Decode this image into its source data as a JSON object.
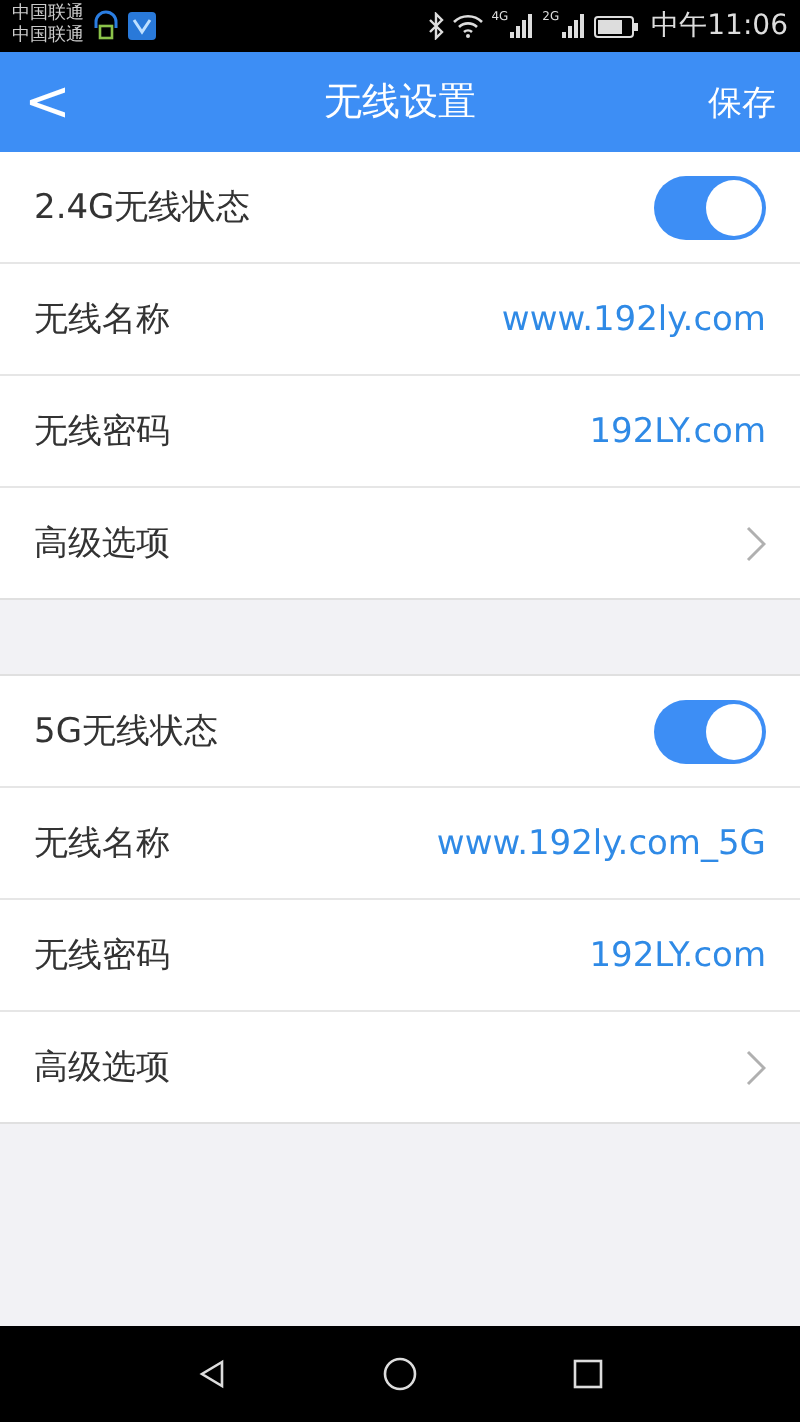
{
  "status_bar": {
    "carriers": [
      "中国联通",
      "中国联通"
    ],
    "time": "中午11:06",
    "network_labels": [
      "4G",
      "2G"
    ]
  },
  "header": {
    "back": "<",
    "title": "无线设置",
    "action": "保存"
  },
  "sections": [
    {
      "rows": [
        {
          "kind": "toggle",
          "label": "2.4G无线状态",
          "on": true
        },
        {
          "kind": "value",
          "label": "无线名称",
          "value": "www.192ly.com"
        },
        {
          "kind": "value",
          "label": "无线密码",
          "value": "192LY.com"
        },
        {
          "kind": "link",
          "label": "高级选项"
        }
      ]
    },
    {
      "rows": [
        {
          "kind": "toggle",
          "label": "5G无线状态",
          "on": true
        },
        {
          "kind": "value",
          "label": "无线名称",
          "value": "www.192ly.com_5G"
        },
        {
          "kind": "value",
          "label": "无线密码",
          "value": "192LY.com"
        },
        {
          "kind": "link",
          "label": "高级选项"
        }
      ]
    }
  ]
}
